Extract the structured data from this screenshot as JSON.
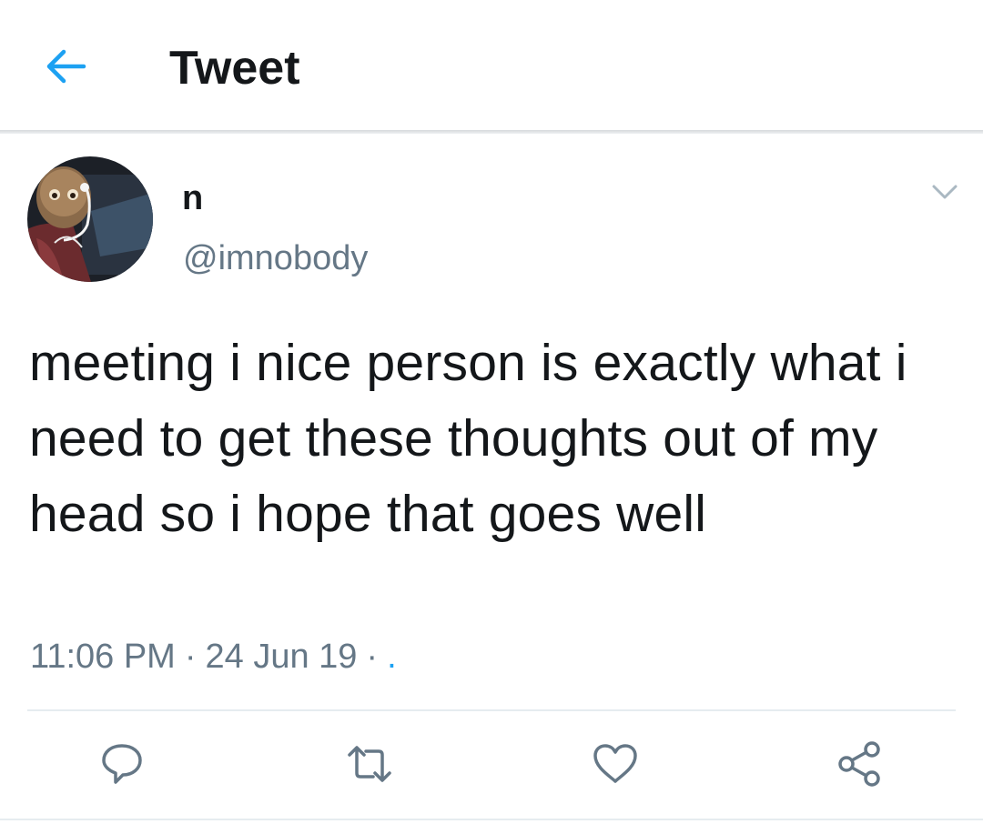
{
  "header": {
    "title": "Tweet",
    "back_icon": "arrow-left-icon",
    "accent_color": "#1da1f2"
  },
  "tweet": {
    "author": {
      "display_name": "n",
      "handle": "@imnobody",
      "avatar": "avatar-image"
    },
    "text": "meeting i nice person is exactly what i need to get these thoughts out of my head so i hope that goes well",
    "time": "11:06 PM",
    "date": "24 Jun 19",
    "separator": "·",
    "source": ".",
    "menu_icon": "chevron-down-icon"
  },
  "actions": [
    {
      "name": "reply",
      "icon": "reply-icon"
    },
    {
      "name": "retweet",
      "icon": "retweet-icon"
    },
    {
      "name": "like",
      "icon": "heart-icon"
    },
    {
      "name": "share",
      "icon": "share-icon"
    }
  ],
  "colors": {
    "text_primary": "#14171a",
    "text_secondary": "#657786",
    "divider": "#e6ecf0"
  }
}
